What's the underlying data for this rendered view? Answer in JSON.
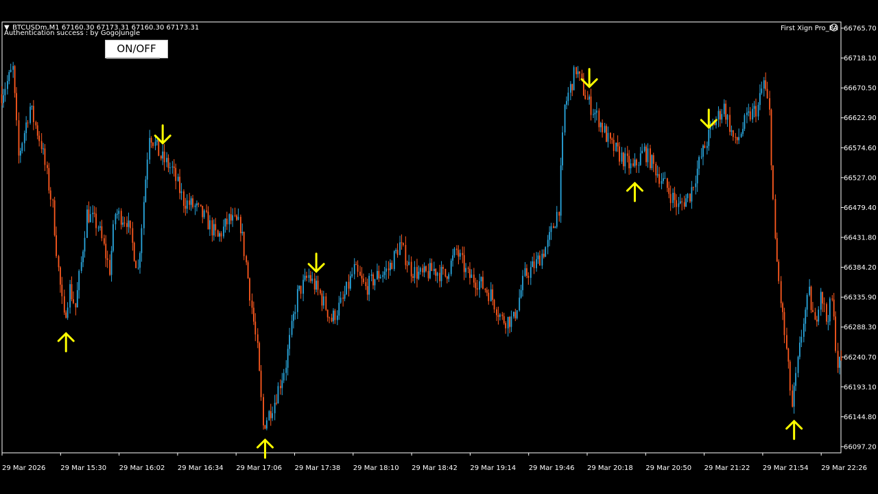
{
  "header": {
    "symbol_line": "BTCUSDm,M1  67160.30 67173.31 67160.30 67173.31",
    "auth_line": "Authentication success : by GogoJungle",
    "ea_name": "First Xign Pro_EA",
    "ea_icon": "smiley-icon",
    "dropdown_icon": "triangle-down-icon"
  },
  "controls": {
    "onoff_label": "ON/OFF"
  },
  "colors": {
    "bull": "#2aa7de",
    "bear": "#ff5a1f",
    "arrow": "#ffff00",
    "axis": "#ffffff",
    "background": "#000000"
  },
  "chart_data": {
    "type": "candlestick",
    "symbol": "BTCUSDm",
    "timeframe": "M1",
    "ylim": [
      66097.2,
      66765.7
    ],
    "y_ticks": [
      "66765.70",
      "66718.10",
      "66670.50",
      "66622.90",
      "66574.60",
      "66527.00",
      "66479.40",
      "66431.80",
      "66384.20",
      "66335.90",
      "66288.30",
      "66240.70",
      "66193.10",
      "66144.80",
      "66097.20"
    ],
    "x_ticks": [
      "29 Mar 2026",
      "29 Mar 15:30",
      "29 Mar 16:02",
      "29 Mar 16:34",
      "29 Mar 17:06",
      "29 Mar 17:38",
      "29 Mar 18:10",
      "29 Mar 18:42",
      "29 Mar 19:14",
      "29 Mar 19:46",
      "29 Mar 20:18",
      "29 Mar 20:50",
      "29 Mar 21:22",
      "29 Mar 21:54",
      "29 Mar 22:26"
    ],
    "price_path": [
      [
        0,
        66660
      ],
      [
        2,
        66700
      ],
      [
        3,
        66560
      ],
      [
        5,
        66640
      ],
      [
        7,
        66580
      ],
      [
        9,
        66480
      ],
      [
        10,
        66380
      ],
      [
        11,
        66300
      ],
      [
        12,
        66350
      ],
      [
        13,
        66320
      ],
      [
        14,
        66390
      ],
      [
        15,
        66470
      ],
      [
        16,
        66460
      ],
      [
        17,
        66450
      ],
      [
        19,
        66380
      ],
      [
        20,
        66470
      ],
      [
        22,
        66460
      ],
      [
        24,
        66380
      ],
      [
        26,
        66600
      ],
      [
        28,
        66560
      ],
      [
        30,
        66540
      ],
      [
        32,
        66490
      ],
      [
        34,
        66480
      ],
      [
        36,
        66460
      ],
      [
        38,
        66430
      ],
      [
        40,
        66460
      ],
      [
        42,
        66450
      ],
      [
        43,
        66390
      ],
      [
        45,
        66250
      ],
      [
        46,
        66130
      ],
      [
        48,
        66170
      ],
      [
        50,
        66230
      ],
      [
        52,
        66340
      ],
      [
        54,
        66370
      ],
      [
        56,
        66340
      ],
      [
        58,
        66300
      ],
      [
        60,
        66330
      ],
      [
        62,
        66380
      ],
      [
        64,
        66350
      ],
      [
        66,
        66370
      ],
      [
        68,
        66380
      ],
      [
        70,
        66420
      ],
      [
        72,
        66380
      ],
      [
        74,
        66370
      ],
      [
        76,
        66380
      ],
      [
        78,
        66370
      ],
      [
        80,
        66410
      ],
      [
        82,
        66370
      ],
      [
        84,
        66360
      ],
      [
        86,
        66340
      ],
      [
        88,
        66300
      ],
      [
        90,
        66300
      ],
      [
        92,
        66370
      ],
      [
        94,
        66390
      ],
      [
        96,
        66420
      ],
      [
        98,
        66480
      ],
      [
        99,
        66640
      ],
      [
        101,
        66700
      ],
      [
        103,
        66650
      ],
      [
        105,
        66620
      ],
      [
        107,
        66580
      ],
      [
        109,
        66560
      ],
      [
        111,
        66540
      ],
      [
        113,
        66570
      ],
      [
        115,
        66540
      ],
      [
        117,
        66510
      ],
      [
        119,
        66480
      ],
      [
        121,
        66500
      ],
      [
        123,
        66560
      ],
      [
        125,
        66610
      ],
      [
        127,
        66640
      ],
      [
        129,
        66580
      ],
      [
        131,
        66620
      ],
      [
        133,
        66640
      ],
      [
        134,
        66680
      ],
      [
        135,
        66630
      ],
      [
        136,
        66420
      ],
      [
        137,
        66330
      ],
      [
        138,
        66250
      ],
      [
        139,
        66160
      ],
      [
        140,
        66230
      ],
      [
        141,
        66300
      ],
      [
        142,
        66340
      ],
      [
        143,
        66290
      ],
      [
        144,
        66350
      ],
      [
        145,
        66300
      ],
      [
        146,
        66330
      ],
      [
        147,
        66230
      ]
    ],
    "signals": [
      {
        "type": "buy",
        "time_index": 11
      },
      {
        "type": "sell",
        "time_index": 28
      },
      {
        "type": "buy",
        "time_index": 46
      },
      {
        "type": "sell",
        "time_index": 55
      },
      {
        "type": "sell",
        "time_index": 103
      },
      {
        "type": "buy",
        "time_index": 111
      },
      {
        "type": "sell",
        "time_index": 124
      },
      {
        "type": "buy",
        "time_index": 139
      }
    ]
  }
}
